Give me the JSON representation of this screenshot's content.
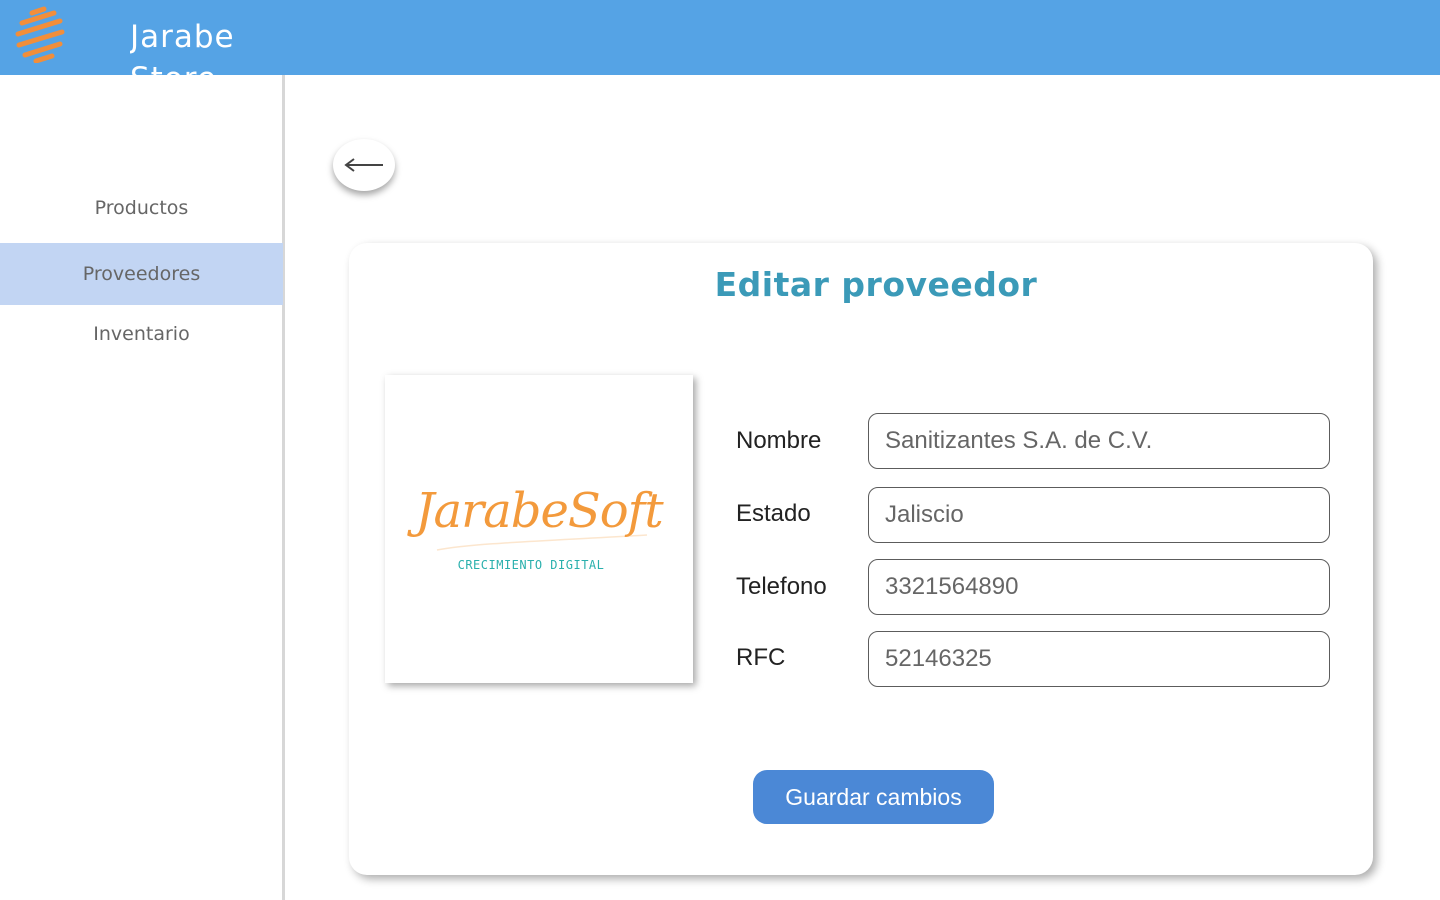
{
  "app": {
    "brand": "Jarabe Store",
    "logo_icon": "orange-sphere-icon",
    "header_color": "#55a3e5"
  },
  "sidebar": {
    "items": [
      {
        "label": "Productos",
        "active": false
      },
      {
        "label": "Proveedores",
        "active": true
      },
      {
        "label": "Inventario",
        "active": false
      }
    ]
  },
  "back_button": {
    "icon": "arrow-left-icon"
  },
  "form": {
    "title": "Editar proveedor",
    "image": {
      "brand_text": "JarabeSoft",
      "tagline": "CRECIMIENTO DIGITAL"
    },
    "fields": [
      {
        "label": "Nombre",
        "value": "Sanitizantes S.A. de C.V."
      },
      {
        "label": "Estado",
        "value": "Jaliscio"
      },
      {
        "label": "Telefono",
        "value": "3321564890"
      },
      {
        "label": "RFC",
        "value": "52146325"
      }
    ],
    "submit_label": "Guardar cambios"
  },
  "colors": {
    "accent": "#4b88d6",
    "title": "#3b9ab8",
    "active_nav": "#c2d5f3",
    "logo_orange": "#f39a3c",
    "tagline_teal": "#2ab0ad"
  }
}
